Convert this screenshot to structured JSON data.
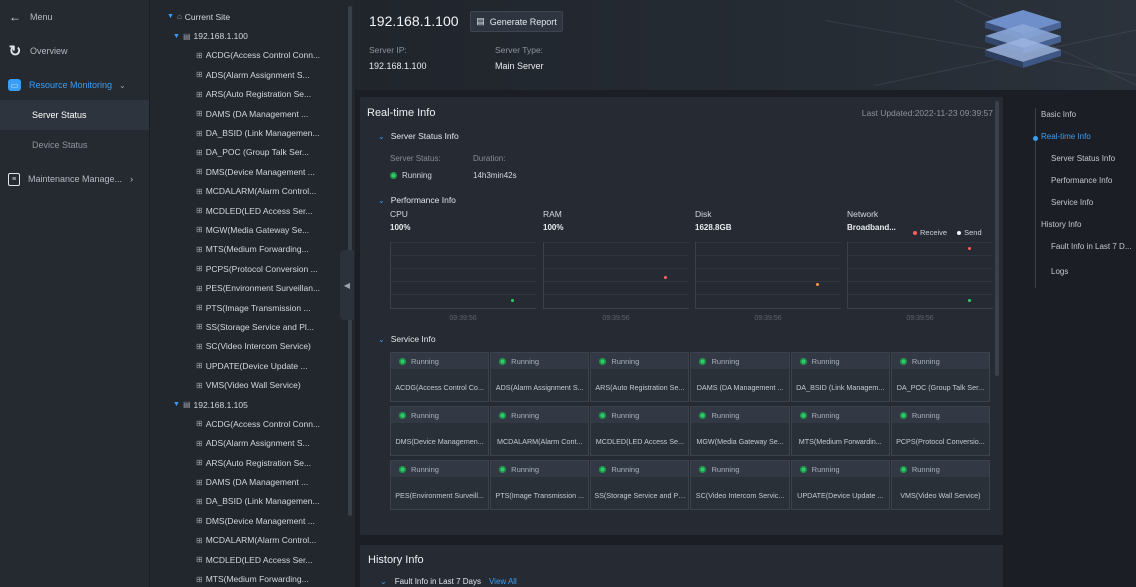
{
  "nav": {
    "back_label": "Menu",
    "items": [
      {
        "label": "Overview",
        "icon": "refresh-icon"
      },
      {
        "label": "Resource Monitoring",
        "icon": "monitor-icon"
      },
      {
        "label": "Server Status"
      },
      {
        "label": "Device Status"
      },
      {
        "label": "Maintenance Manage...",
        "icon": "clipboard-icon"
      }
    ]
  },
  "tree": {
    "root": "Current Site",
    "nodes": [
      {
        "type": "server",
        "label": "192.168.1.100"
      },
      {
        "type": "svc",
        "label": "ACDG(Access Control Conn..."
      },
      {
        "type": "svc",
        "label": "ADS(Alarm Assignment S..."
      },
      {
        "type": "svc",
        "label": "ARS(Auto Registration Se..."
      },
      {
        "type": "svc",
        "label": "DAMS (DA Management ..."
      },
      {
        "type": "svc",
        "label": "DA_BSID (Link Managemen..."
      },
      {
        "type": "svc",
        "label": "DA_POC (Group Talk Ser..."
      },
      {
        "type": "svc",
        "label": "DMS(Device Management ..."
      },
      {
        "type": "svc",
        "label": "MCDALARM(Alarm Control..."
      },
      {
        "type": "svc",
        "label": "MCDLED(LED Access Ser..."
      },
      {
        "type": "svc",
        "label": "MGW(Media Gateway Se..."
      },
      {
        "type": "svc",
        "label": "MTS(Medium Forwarding..."
      },
      {
        "type": "svc",
        "label": "PCPS(Protocol Conversion ..."
      },
      {
        "type": "svc",
        "label": "PES(Environment Surveillan..."
      },
      {
        "type": "svc",
        "label": "PTS(Image Transmission ..."
      },
      {
        "type": "svc",
        "label": "SS(Storage Service and Pl..."
      },
      {
        "type": "svc",
        "label": "SC(Video Intercom Service)"
      },
      {
        "type": "svc",
        "label": "UPDATE(Device Update ..."
      },
      {
        "type": "svc",
        "label": "VMS(Video Wall Service)"
      },
      {
        "type": "server",
        "label": "192.168.1.105"
      },
      {
        "type": "svc",
        "label": "ACDG(Access Control Conn..."
      },
      {
        "type": "svc",
        "label": "ADS(Alarm Assignment S..."
      },
      {
        "type": "svc",
        "label": "ARS(Auto Registration Se..."
      },
      {
        "type": "svc",
        "label": "DAMS (DA Management ..."
      },
      {
        "type": "svc",
        "label": "DA_BSID (Link Managemen..."
      },
      {
        "type": "svc",
        "label": "DMS(Device Management ..."
      },
      {
        "type": "svc",
        "label": "MCDALARM(Alarm Control..."
      },
      {
        "type": "svc",
        "label": "MCDLED(LED Access Ser..."
      },
      {
        "type": "svc",
        "label": "MTS(Medium Forwarding..."
      }
    ]
  },
  "header": {
    "title": "192.168.1.100",
    "report_button": "Generate Report",
    "server_ip_label": "Server IP:",
    "server_ip": "192.168.1.100",
    "server_type_label": "Server Type:",
    "server_type": "Main Server"
  },
  "realtime": {
    "title": "Real-time Info",
    "last_updated": "Last Updated:2022-11-23 09:39:57",
    "status_section": "Server Status Info",
    "status_label": "Server Status:",
    "status_value": "Running",
    "duration_label": "Duration:",
    "duration_value": "14h3min42s",
    "perf_section": "Performance Info",
    "perf": [
      {
        "name": "CPU",
        "value": "100%",
        "time": "09:39:56",
        "dot_color": "#2fcc6b",
        "level": 0.1
      },
      {
        "name": "RAM",
        "value": "100%",
        "time": "09:39:56",
        "dot_color": "#ff6b6b",
        "level": 0.45
      },
      {
        "name": "Disk",
        "value": "1628.8GB",
        "time": "09:39:56",
        "dot_color": "#f2994a",
        "level": 0.35
      },
      {
        "name": "Network",
        "value": "Broadband...",
        "time": "09:39:56",
        "dot_color": "#2fcc6b",
        "level": 0.1
      }
    ],
    "legend": [
      {
        "label": "Receive",
        "color": "#ff5c5c"
      },
      {
        "label": "Send",
        "color": "#f2f4f7"
      }
    ],
    "service_section": "Service Info",
    "services": [
      {
        "status": "Running",
        "name": "ACDG(Access Control Co..."
      },
      {
        "status": "Running",
        "name": "ADS(Alarm Assignment S..."
      },
      {
        "status": "Running",
        "name": "ARS(Auto Registration Se..."
      },
      {
        "status": "Running",
        "name": "DAMS (DA Management ..."
      },
      {
        "status": "Running",
        "name": "DA_BSID (Link Managem..."
      },
      {
        "status": "Running",
        "name": "DA_POC (Group Talk Ser..."
      },
      {
        "status": "Running",
        "name": "DMS(Device Managemen..."
      },
      {
        "status": "Running",
        "name": "MCDALARM(Alarm Cont..."
      },
      {
        "status": "Running",
        "name": "MCDLED(LED Access Se..."
      },
      {
        "status": "Running",
        "name": "MGW(Media Gateway Se..."
      },
      {
        "status": "Running",
        "name": "MTS(Medium Forwardin..."
      },
      {
        "status": "Running",
        "name": "PCPS(Protocol Conversio..."
      },
      {
        "status": "Running",
        "name": "PES(Environment Surveill..."
      },
      {
        "status": "Running",
        "name": "PTS(Image Transmission ..."
      },
      {
        "status": "Running",
        "name": "SS(Storage Service and Pl..."
      },
      {
        "status": "Running",
        "name": "SC(Video Intercom Servic..."
      },
      {
        "status": "Running",
        "name": "UPDATE(Device Update ..."
      },
      {
        "status": "Running",
        "name": "VMS(Video Wall Service)"
      }
    ]
  },
  "history": {
    "title": "History Info",
    "fault_section": "Fault Info in Last 7 Days",
    "view_all": "View All"
  },
  "anchor": {
    "items": [
      {
        "label": "Basic Info"
      },
      {
        "label": "Real-time Info",
        "active": true
      },
      {
        "label": "Server Status Info"
      },
      {
        "label": "Performance Info"
      },
      {
        "label": "Service Info"
      },
      {
        "label": "History Info"
      },
      {
        "label": "Fault Info in Last 7 D..."
      },
      {
        "label": "Logs"
      }
    ]
  },
  "colors": {
    "accent": "#3b9ef5",
    "running": "#2fcc6b",
    "background": "#1b1f25",
    "panel": "#262b33"
  }
}
